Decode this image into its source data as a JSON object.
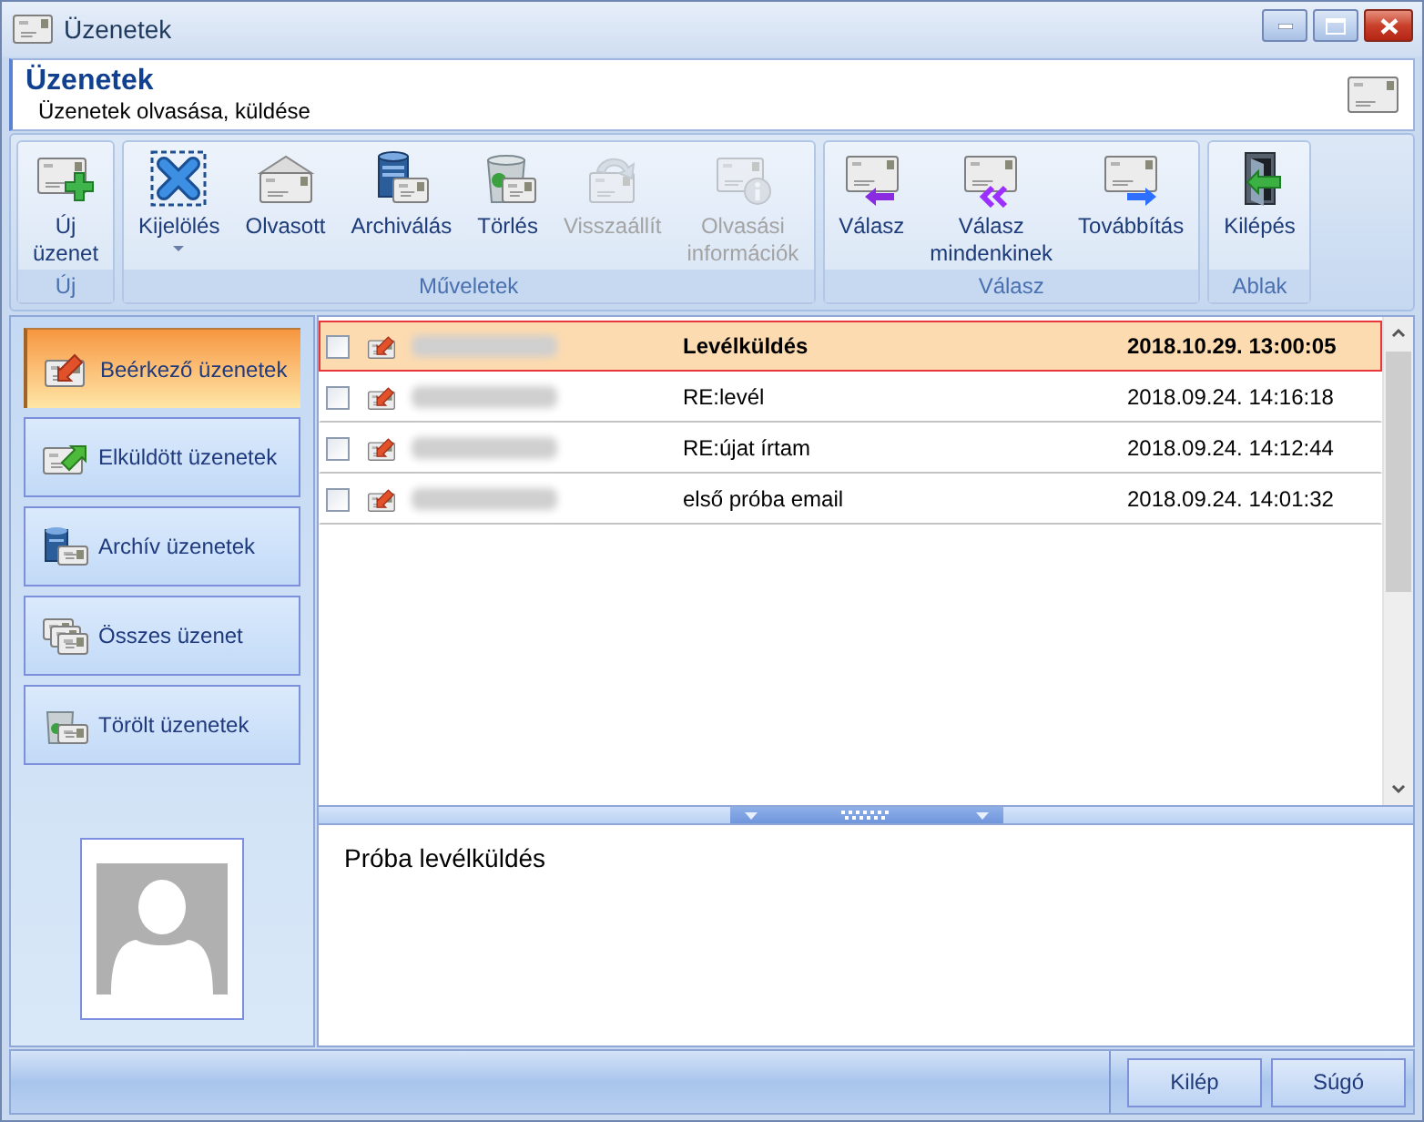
{
  "window": {
    "title": "Üzenetek"
  },
  "header": {
    "title": "Üzenetek",
    "subtitle": "Üzenetek olvasása, küldése"
  },
  "ribbon": {
    "groups": [
      {
        "label": "Új",
        "buttons": [
          {
            "label": "Új\nüzenet",
            "disabled": false,
            "dropdown": false
          }
        ]
      },
      {
        "label": "Műveletek",
        "buttons": [
          {
            "label": "Kijelölés",
            "disabled": false,
            "dropdown": true
          },
          {
            "label": "Olvasott",
            "disabled": false,
            "dropdown": false
          },
          {
            "label": "Archiválás",
            "disabled": false,
            "dropdown": false
          },
          {
            "label": "Törlés",
            "disabled": false,
            "dropdown": false
          },
          {
            "label": "Visszaállít",
            "disabled": true,
            "dropdown": false
          },
          {
            "label": "Olvasási\ninformációk",
            "disabled": true,
            "dropdown": false
          }
        ]
      },
      {
        "label": "Válasz",
        "buttons": [
          {
            "label": "Válasz",
            "disabled": false,
            "dropdown": false
          },
          {
            "label": "Válasz\nmindenkinek",
            "disabled": false,
            "dropdown": false
          },
          {
            "label": "Továbbítás",
            "disabled": false,
            "dropdown": false
          }
        ]
      },
      {
        "label": "Ablak",
        "buttons": [
          {
            "label": "Kilépés",
            "disabled": false,
            "dropdown": false
          }
        ]
      }
    ]
  },
  "sidebar": {
    "items": [
      {
        "label": "Beérkező üzenetek",
        "selected": true
      },
      {
        "label": "Elküldött üzenetek",
        "selected": false
      },
      {
        "label": "Archív üzenetek",
        "selected": false
      },
      {
        "label": "Összes üzenet",
        "selected": false
      },
      {
        "label": "Törölt üzenetek",
        "selected": false
      }
    ]
  },
  "messages": {
    "rows": [
      {
        "checked": false,
        "selected": true,
        "unread": true,
        "subject": "Levélküldés",
        "date": "2018.10.29. 13:00:05"
      },
      {
        "checked": false,
        "selected": false,
        "unread": false,
        "subject": "RE:levél",
        "date": "2018.09.24. 14:16:18"
      },
      {
        "checked": false,
        "selected": false,
        "unread": false,
        "subject": "RE:újat írtam",
        "date": "2018.09.24. 14:12:44"
      },
      {
        "checked": false,
        "selected": false,
        "unread": false,
        "subject": "első próba email",
        "date": "2018.09.24. 14:01:32"
      }
    ]
  },
  "preview": {
    "text": "Próba levélküldés"
  },
  "footer": {
    "buttons": [
      "Kilép",
      "Súgó"
    ]
  }
}
